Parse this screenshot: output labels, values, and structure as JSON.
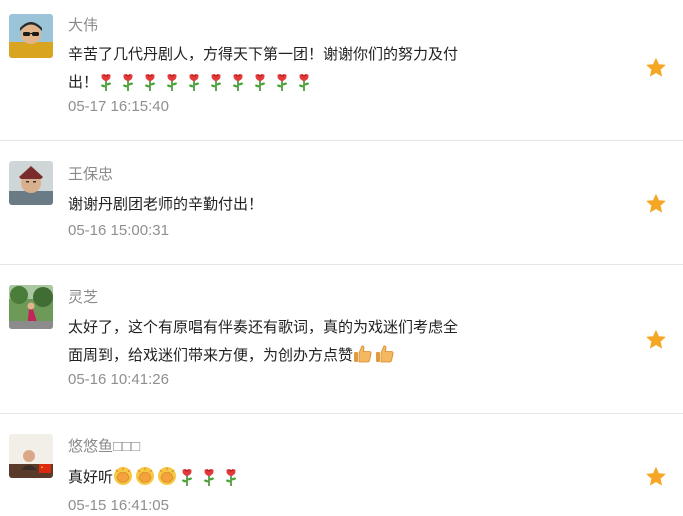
{
  "comments": [
    {
      "username": "大伟",
      "text": "辛苦了几代丹剧人，方得天下第一团！谢谢你们的努力及付出！",
      "emojis": [
        "rose",
        "rose",
        "rose",
        "rose",
        "rose",
        "rose",
        "rose",
        "rose",
        "rose",
        "rose"
      ],
      "time": "05-17 16:15:40",
      "favorite": true
    },
    {
      "username": "王保忠",
      "text": "谢谢丹剧团老师的辛勤付出！",
      "emojis": [],
      "time": "05-16 15:00:31",
      "favorite": true
    },
    {
      "username": "灵芝",
      "text": "太好了，这个有原唱有伴奏还有歌词，真的为戏迷们考虑全面周到，给戏迷们带来方便，为创办方点赞",
      "emojis": [
        "thumbs-up",
        "thumbs-up"
      ],
      "time": "05-16 10:41:26",
      "favorite": true
    },
    {
      "username": "悠悠鱼□□□",
      "text": "真好听",
      "emojis": [
        "applause",
        "applause",
        "applause",
        "rose",
        "rose",
        "rose"
      ],
      "time": "05-15 16:41:05",
      "favorite": true
    }
  ],
  "colors": {
    "star": "#f5a623",
    "username": "#8a8a8a",
    "text": "#222222",
    "time": "#8f8f8f",
    "divider": "#e6e6e6"
  }
}
